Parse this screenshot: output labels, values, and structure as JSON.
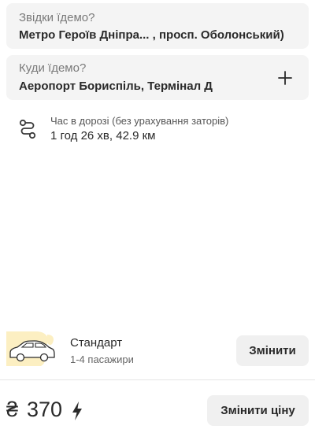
{
  "from": {
    "label": "Звідки їдемо?",
    "value": "Метро Героїв Дніпра... , просп. Оболонський)"
  },
  "to": {
    "label": "Куди їдемо?",
    "value": "Аеропорт Бориспіль, Термінал Д",
    "add_icon": "plus-icon"
  },
  "route": {
    "icon": "route-icon",
    "caption": "Час в дорозі (без урахування заторів)",
    "value": "1 год 26 хв, 42.9 км"
  },
  "tariff": {
    "icon": "car-icon",
    "name": "Стандарт",
    "seats": "1-4 пасажири",
    "change_label": "Змінити"
  },
  "price": {
    "currency": "₴",
    "amount": "370",
    "icon": "lightning-bolt-icon",
    "change_label": "Змінити ціну"
  },
  "colors": {
    "field_bg": "#f4f4f4",
    "button_bg": "#f0f0f0",
    "accent_yellow": "#fcefc2",
    "text": "#2a2a2a",
    "muted": "#7a7a7a"
  }
}
